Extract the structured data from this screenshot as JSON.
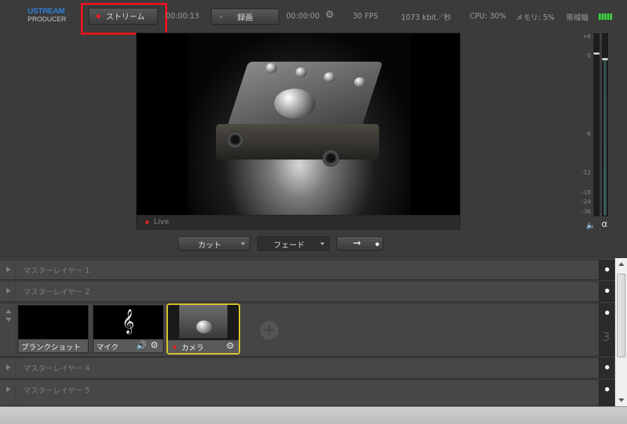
{
  "app": {
    "logo_line1": "USTREAM",
    "logo_line2": "PRODUCER"
  },
  "toolbar": {
    "stream_label": "ストリーム",
    "stream_time": "00:00:13",
    "record_label": "録画",
    "record_time": "00:00:00",
    "fps": "30 FPS",
    "bitrate": "1073 kbit／秒",
    "cpu": "CPU: 30%",
    "memory": "メモリ: 5%",
    "bandwidth_label": "帯域幅",
    "bandwidth_bars": 5
  },
  "preview": {
    "status": "Live"
  },
  "transitions": {
    "cut_label": "カット",
    "fade_label": "フェード",
    "go_icon": "arrow-right-icon"
  },
  "meter": {
    "scale": [
      "+6",
      "0",
      "-6",
      "-12",
      "-18",
      "-24",
      "-36"
    ],
    "left_level": 0.0,
    "right_level": 0.87
  },
  "layers": [
    {
      "name": "マスターレイヤー 1"
    },
    {
      "name": "マスターレイヤー 2"
    },
    {
      "number": "3"
    },
    {
      "name": "マスターレイヤー 4"
    },
    {
      "name": "マスターレイヤー 5"
    }
  ],
  "shots": [
    {
      "label": "ブランクショット",
      "live": false
    },
    {
      "label": "マイク",
      "live": false
    },
    {
      "label": "カメラ",
      "live": true
    }
  ],
  "colors": {
    "accent_blue": "#2f7fd6",
    "live_red": "#e0202a",
    "highlight": "#e8141b",
    "selected_shot": "#e3cd2b",
    "bandwidth_green": "#3ed13e"
  }
}
